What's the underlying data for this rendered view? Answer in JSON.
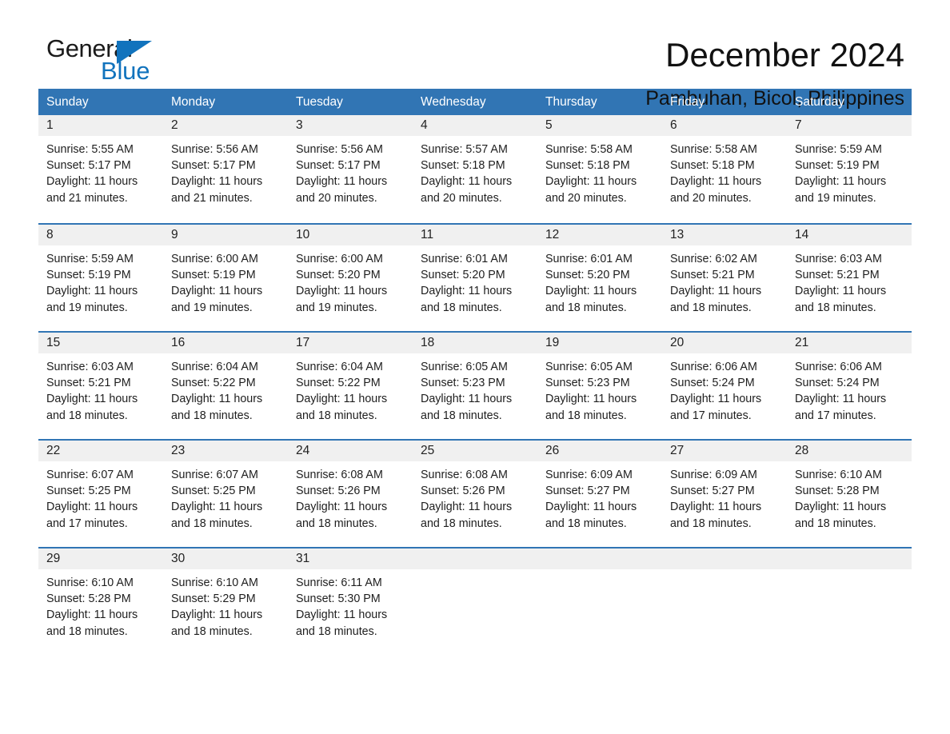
{
  "logo": {
    "word_one": "General",
    "word_two": "Blue",
    "triangle_color": "#1173bd"
  },
  "header": {
    "title": "December 2024",
    "location": "Pambuhan, Bicol, Philippines"
  },
  "theme": {
    "header_blue": "#3175b4",
    "day_band_gray": "#f0f0f0",
    "text_color": "#1e1e1e"
  },
  "calendar": {
    "weekdays": [
      "Sunday",
      "Monday",
      "Tuesday",
      "Wednesday",
      "Thursday",
      "Friday",
      "Saturday"
    ],
    "weeks": [
      [
        {
          "day": "1",
          "sunrise": "Sunrise: 5:55 AM",
          "sunset": "Sunset: 5:17 PM",
          "daylight_line1": "Daylight: 11 hours",
          "daylight_line2": "and 21 minutes."
        },
        {
          "day": "2",
          "sunrise": "Sunrise: 5:56 AM",
          "sunset": "Sunset: 5:17 PM",
          "daylight_line1": "Daylight: 11 hours",
          "daylight_line2": "and 21 minutes."
        },
        {
          "day": "3",
          "sunrise": "Sunrise: 5:56 AM",
          "sunset": "Sunset: 5:17 PM",
          "daylight_line1": "Daylight: 11 hours",
          "daylight_line2": "and 20 minutes."
        },
        {
          "day": "4",
          "sunrise": "Sunrise: 5:57 AM",
          "sunset": "Sunset: 5:18 PM",
          "daylight_line1": "Daylight: 11 hours",
          "daylight_line2": "and 20 minutes."
        },
        {
          "day": "5",
          "sunrise": "Sunrise: 5:58 AM",
          "sunset": "Sunset: 5:18 PM",
          "daylight_line1": "Daylight: 11 hours",
          "daylight_line2": "and 20 minutes."
        },
        {
          "day": "6",
          "sunrise": "Sunrise: 5:58 AM",
          "sunset": "Sunset: 5:18 PM",
          "daylight_line1": "Daylight: 11 hours",
          "daylight_line2": "and 20 minutes."
        },
        {
          "day": "7",
          "sunrise": "Sunrise: 5:59 AM",
          "sunset": "Sunset: 5:19 PM",
          "daylight_line1": "Daylight: 11 hours",
          "daylight_line2": "and 19 minutes."
        }
      ],
      [
        {
          "day": "8",
          "sunrise": "Sunrise: 5:59 AM",
          "sunset": "Sunset: 5:19 PM",
          "daylight_line1": "Daylight: 11 hours",
          "daylight_line2": "and 19 minutes."
        },
        {
          "day": "9",
          "sunrise": "Sunrise: 6:00 AM",
          "sunset": "Sunset: 5:19 PM",
          "daylight_line1": "Daylight: 11 hours",
          "daylight_line2": "and 19 minutes."
        },
        {
          "day": "10",
          "sunrise": "Sunrise: 6:00 AM",
          "sunset": "Sunset: 5:20 PM",
          "daylight_line1": "Daylight: 11 hours",
          "daylight_line2": "and 19 minutes."
        },
        {
          "day": "11",
          "sunrise": "Sunrise: 6:01 AM",
          "sunset": "Sunset: 5:20 PM",
          "daylight_line1": "Daylight: 11 hours",
          "daylight_line2": "and 18 minutes."
        },
        {
          "day": "12",
          "sunrise": "Sunrise: 6:01 AM",
          "sunset": "Sunset: 5:20 PM",
          "daylight_line1": "Daylight: 11 hours",
          "daylight_line2": "and 18 minutes."
        },
        {
          "day": "13",
          "sunrise": "Sunrise: 6:02 AM",
          "sunset": "Sunset: 5:21 PM",
          "daylight_line1": "Daylight: 11 hours",
          "daylight_line2": "and 18 minutes."
        },
        {
          "day": "14",
          "sunrise": "Sunrise: 6:03 AM",
          "sunset": "Sunset: 5:21 PM",
          "daylight_line1": "Daylight: 11 hours",
          "daylight_line2": "and 18 minutes."
        }
      ],
      [
        {
          "day": "15",
          "sunrise": "Sunrise: 6:03 AM",
          "sunset": "Sunset: 5:21 PM",
          "daylight_line1": "Daylight: 11 hours",
          "daylight_line2": "and 18 minutes."
        },
        {
          "day": "16",
          "sunrise": "Sunrise: 6:04 AM",
          "sunset": "Sunset: 5:22 PM",
          "daylight_line1": "Daylight: 11 hours",
          "daylight_line2": "and 18 minutes."
        },
        {
          "day": "17",
          "sunrise": "Sunrise: 6:04 AM",
          "sunset": "Sunset: 5:22 PM",
          "daylight_line1": "Daylight: 11 hours",
          "daylight_line2": "and 18 minutes."
        },
        {
          "day": "18",
          "sunrise": "Sunrise: 6:05 AM",
          "sunset": "Sunset: 5:23 PM",
          "daylight_line1": "Daylight: 11 hours",
          "daylight_line2": "and 18 minutes."
        },
        {
          "day": "19",
          "sunrise": "Sunrise: 6:05 AM",
          "sunset": "Sunset: 5:23 PM",
          "daylight_line1": "Daylight: 11 hours",
          "daylight_line2": "and 18 minutes."
        },
        {
          "day": "20",
          "sunrise": "Sunrise: 6:06 AM",
          "sunset": "Sunset: 5:24 PM",
          "daylight_line1": "Daylight: 11 hours",
          "daylight_line2": "and 17 minutes."
        },
        {
          "day": "21",
          "sunrise": "Sunrise: 6:06 AM",
          "sunset": "Sunset: 5:24 PM",
          "daylight_line1": "Daylight: 11 hours",
          "daylight_line2": "and 17 minutes."
        }
      ],
      [
        {
          "day": "22",
          "sunrise": "Sunrise: 6:07 AM",
          "sunset": "Sunset: 5:25 PM",
          "daylight_line1": "Daylight: 11 hours",
          "daylight_line2": "and 17 minutes."
        },
        {
          "day": "23",
          "sunrise": "Sunrise: 6:07 AM",
          "sunset": "Sunset: 5:25 PM",
          "daylight_line1": "Daylight: 11 hours",
          "daylight_line2": "and 18 minutes."
        },
        {
          "day": "24",
          "sunrise": "Sunrise: 6:08 AM",
          "sunset": "Sunset: 5:26 PM",
          "daylight_line1": "Daylight: 11 hours",
          "daylight_line2": "and 18 minutes."
        },
        {
          "day": "25",
          "sunrise": "Sunrise: 6:08 AM",
          "sunset": "Sunset: 5:26 PM",
          "daylight_line1": "Daylight: 11 hours",
          "daylight_line2": "and 18 minutes."
        },
        {
          "day": "26",
          "sunrise": "Sunrise: 6:09 AM",
          "sunset": "Sunset: 5:27 PM",
          "daylight_line1": "Daylight: 11 hours",
          "daylight_line2": "and 18 minutes."
        },
        {
          "day": "27",
          "sunrise": "Sunrise: 6:09 AM",
          "sunset": "Sunset: 5:27 PM",
          "daylight_line1": "Daylight: 11 hours",
          "daylight_line2": "and 18 minutes."
        },
        {
          "day": "28",
          "sunrise": "Sunrise: 6:10 AM",
          "sunset": "Sunset: 5:28 PM",
          "daylight_line1": "Daylight: 11 hours",
          "daylight_line2": "and 18 minutes."
        }
      ],
      [
        {
          "day": "29",
          "sunrise": "Sunrise: 6:10 AM",
          "sunset": "Sunset: 5:28 PM",
          "daylight_line1": "Daylight: 11 hours",
          "daylight_line2": "and 18 minutes."
        },
        {
          "day": "30",
          "sunrise": "Sunrise: 6:10 AM",
          "sunset": "Sunset: 5:29 PM",
          "daylight_line1": "Daylight: 11 hours",
          "daylight_line2": "and 18 minutes."
        },
        {
          "day": "31",
          "sunrise": "Sunrise: 6:11 AM",
          "sunset": "Sunset: 5:30 PM",
          "daylight_line1": "Daylight: 11 hours",
          "daylight_line2": "and 18 minutes."
        },
        {
          "day": "",
          "sunrise": "",
          "sunset": "",
          "daylight_line1": "",
          "daylight_line2": ""
        },
        {
          "day": "",
          "sunrise": "",
          "sunset": "",
          "daylight_line1": "",
          "daylight_line2": ""
        },
        {
          "day": "",
          "sunrise": "",
          "sunset": "",
          "daylight_line1": "",
          "daylight_line2": ""
        },
        {
          "day": "",
          "sunrise": "",
          "sunset": "",
          "daylight_line1": "",
          "daylight_line2": ""
        }
      ]
    ]
  }
}
